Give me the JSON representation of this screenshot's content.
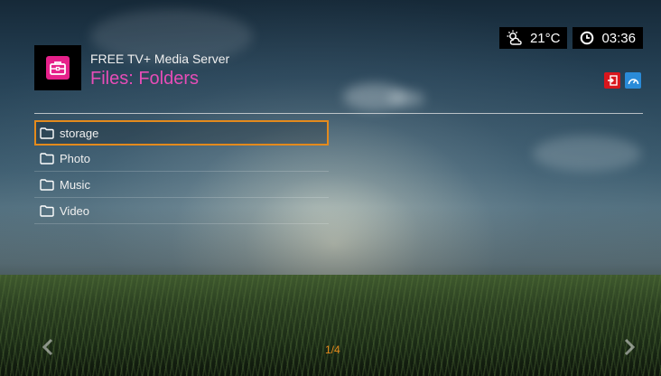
{
  "status": {
    "temperature": "21°C",
    "time": "03:36",
    "weather_icon": "partly-sunny-icon",
    "clock_icon": "clock-icon"
  },
  "header": {
    "server_name": "FREE TV+ Media Server",
    "title": "Files: Folders",
    "app_icon": "briefcase-icon"
  },
  "quick_icons": [
    {
      "icon": "exit-icon",
      "color": "#d9161d"
    },
    {
      "icon": "speedometer-icon",
      "color": "#2a8bd8"
    }
  ],
  "folders": [
    {
      "label": "storage",
      "selected": true
    },
    {
      "label": "Photo",
      "selected": false
    },
    {
      "label": "Music",
      "selected": false
    },
    {
      "label": "Video",
      "selected": false
    }
  ],
  "pagination": {
    "text": "1/4"
  },
  "colors": {
    "accent_title": "#e64db7",
    "selection": "#e48a1c",
    "app_icon_bg": "#e6218a"
  }
}
